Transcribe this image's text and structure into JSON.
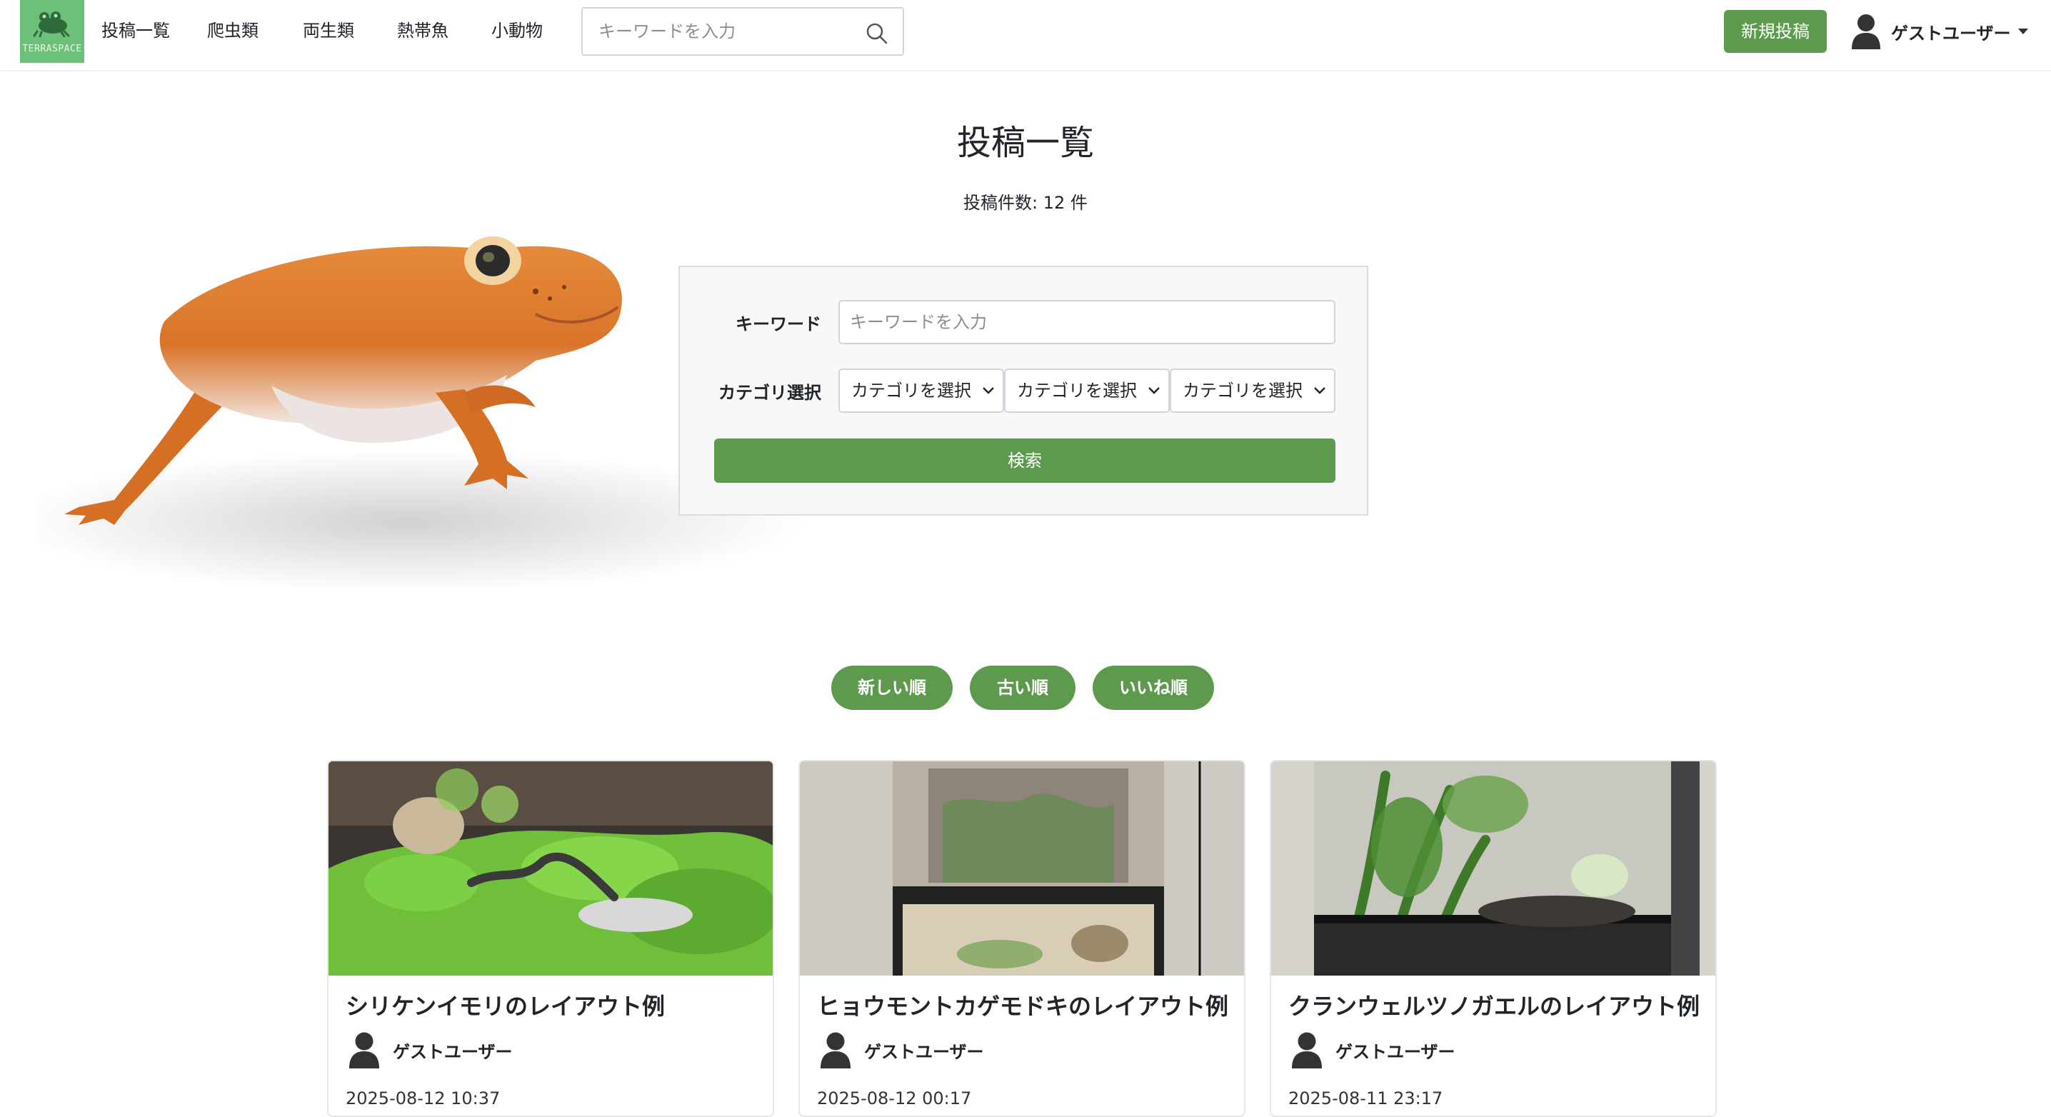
{
  "brand": {
    "logo_text": "TERRASPACE",
    "accent": "#5e9a4e",
    "logo_bg": "#6cc07a"
  },
  "nav": {
    "links": [
      "投稿一覧",
      "爬虫類",
      "両生類",
      "熱帯魚",
      "小動物"
    ],
    "search_placeholder": "キーワードを入力",
    "search_icon": "search-icon",
    "new_post_label": "新規投稿",
    "user_name": "ゲストユーザー"
  },
  "page": {
    "title": "投稿一覧",
    "post_count": "投稿件数: 12 件"
  },
  "search_form": {
    "keyword_label": "キーワード",
    "keyword_placeholder": "キーワードを入力",
    "category_label": "カテゴリ選択",
    "category_selects": [
      "カテゴリを選択",
      "カテゴリを選択",
      "カテゴリを選択"
    ],
    "submit_label": "検索"
  },
  "sort": {
    "buttons": [
      "新しい順",
      "古い順",
      "いいね順"
    ]
  },
  "posts": [
    {
      "title": "シリケンイモリのレイアウト例",
      "author": "ゲストユーザー",
      "date": "2025-08-12 10:37"
    },
    {
      "title": "ヒョウモントカゲモドキのレイアウト例",
      "author": "ゲストユーザー",
      "date": "2025-08-12 00:17"
    },
    {
      "title": "クランウェルツノガエルのレイアウト例",
      "author": "ゲストユーザー",
      "date": "2025-08-11 23:17"
    }
  ]
}
